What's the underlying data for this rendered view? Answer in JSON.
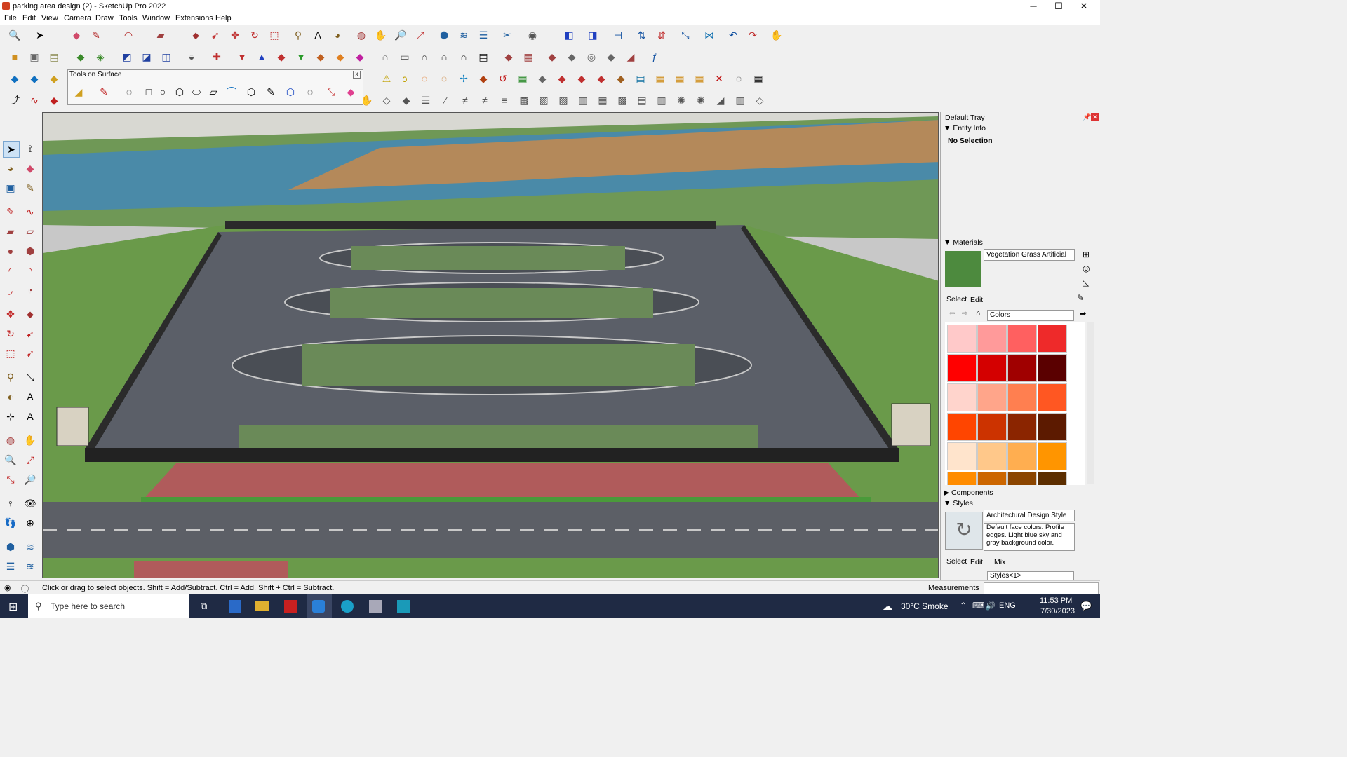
{
  "window": {
    "title": "parking area design (2) - SketchUp Pro 2022",
    "minimize": "─",
    "maximize": "☐",
    "close": "✕"
  },
  "menu": [
    "File",
    "Edit",
    "View",
    "Camera",
    "Draw",
    "Tools",
    "Window",
    "Extensions",
    "Help"
  ],
  "tools_on_surface": {
    "title": "Tools on Surface",
    "close": "x"
  },
  "tray": {
    "title": "Default Tray",
    "entity_info": {
      "title": "Entity Info",
      "selection": "No Selection"
    },
    "materials": {
      "title": "Materials",
      "current": "Vegetation Grass Artificial",
      "tab_select": "Select",
      "tab_edit": "Edit",
      "library": "Colors",
      "swatches": [
        "#ffc9c9",
        "#ff9a9a",
        "#ff6060",
        "#ee2a2a",
        "#ff0000",
        "#d40000",
        "#a00000",
        "#5a0000",
        "#ffd4cc",
        "#ffa58a",
        "#ff7f50",
        "#ff5722",
        "#ff4500",
        "#cc3300",
        "#8b2500",
        "#5c1a00",
        "#ffe4cc",
        "#ffc88a",
        "#ffae50",
        "#ff9500",
        "#ff8c00",
        "#cc6600",
        "#8b4500",
        "#5c2e00"
      ]
    },
    "components": {
      "title": "Components"
    },
    "styles": {
      "title": "Styles",
      "name": "Architectural Design Style",
      "description": "Default face colors. Profile edges. Light blue sky and gray background color.",
      "tab_select": "Select",
      "tab_edit": "Edit",
      "tab_mix": "Mix",
      "collection": "Styles<1>"
    }
  },
  "status": {
    "hint": "Click or drag to select objects. Shift = Add/Subtract. Ctrl = Add. Shift + Ctrl = Subtract.",
    "measurements_label": "Measurements"
  },
  "taskbar": {
    "search_placeholder": "Type here to search",
    "weather": "30°C  Smoke",
    "language": "ENG",
    "time": "11:53 PM",
    "date": "7/30/2023"
  },
  "colors": {
    "grass": "#6a9a4a",
    "road": "#5b5f68",
    "water": "#4a8aa8",
    "sand": "#b48a5a",
    "pavement": "#b06060"
  }
}
